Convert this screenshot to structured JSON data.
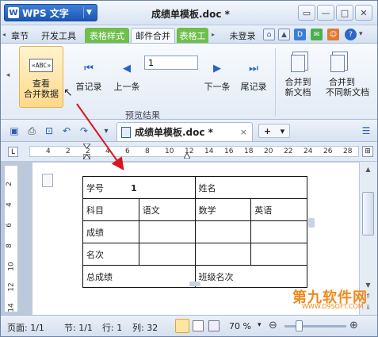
{
  "titlebar": {
    "app_label": "WPS 文字",
    "app_logo": "W",
    "doc_title": "成绩单模板.doc *",
    "window_buttons": [
      "restore",
      "minimize",
      "maximize",
      "close"
    ]
  },
  "menu": {
    "tabs": [
      "章节",
      "开发工具",
      "表格样式",
      "邮件合并",
      "表格工"
    ],
    "login": "未登录"
  },
  "ribbon": {
    "view_merge": "查看\n合并数据",
    "view_merge_l1": "查看",
    "view_merge_l2": "合并数据",
    "first": "首记录",
    "prev": "上一条",
    "record_value": "1",
    "next": "下一条",
    "last": "尾记录",
    "merge_new_l1": "合并到",
    "merge_new_l2": "新文档",
    "merge_diff_l1": "合并到",
    "merge_diff_l2": "不同新文档",
    "group_preview": "预览结果",
    "view_icon_text": "«ABC»"
  },
  "toolbar": {
    "doc_tab": "成绩单模板.doc *",
    "close": "×",
    "plus": "+",
    "dropdown": "▾"
  },
  "ruler": {
    "marks": [
      "4",
      "2",
      "2",
      "4",
      "6",
      "8",
      "10",
      "12",
      "14",
      "16",
      "18",
      "20",
      "22",
      "24",
      "26",
      "28"
    ],
    "tab_label": "L"
  },
  "vruler_marks": [
    "2",
    "4",
    "6",
    "8",
    "10",
    "12",
    "14"
  ],
  "table": {
    "rows": [
      [
        "学号",
        "1",
        "姓名",
        ""
      ],
      [
        "科目",
        "语文",
        "数学",
        "英语"
      ],
      [
        "成绩",
        "",
        "",
        ""
      ],
      [
        "名次",
        "",
        "",
        ""
      ],
      [
        "总成绩",
        "",
        "班级名次",
        ""
      ]
    ]
  },
  "statusbar": {
    "page": "页面: 1/1",
    "section": "节: 1/1",
    "row": "行: 1",
    "col": "列: 32",
    "zoom": "70 %",
    "zoom_minus": "⊖",
    "zoom_plus": "⊕"
  },
  "watermark": {
    "text": "第九软件网",
    "sub": "WWW.D9SOFT.COM"
  },
  "colors": {
    "accent": "#1c56b5",
    "green_tab": "#6fbf4c",
    "arrow": "#d8161e",
    "watermark": "#f08a1c"
  }
}
